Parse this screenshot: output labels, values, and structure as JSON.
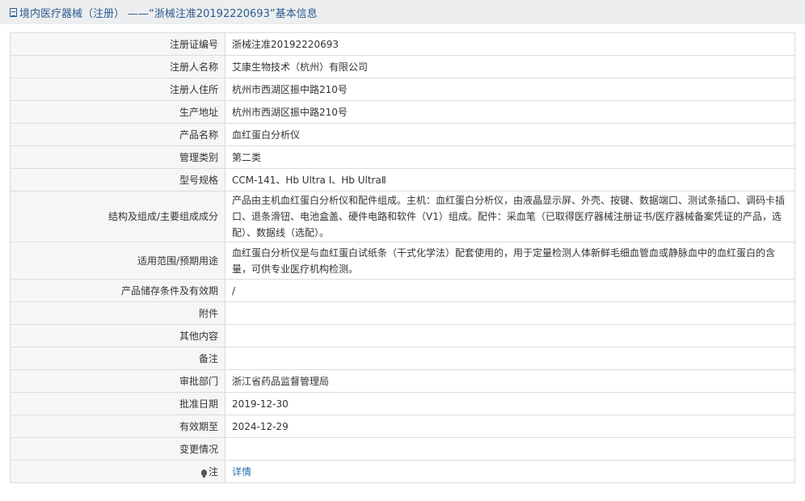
{
  "header": {
    "title": "境内医疗器械（注册） ——“浙械注准20192220693”基本信息"
  },
  "rows": [
    {
      "label": "注册证编号",
      "value": "浙械注准20192220693"
    },
    {
      "label": "注册人名称",
      "value": "艾康生物技术（杭州）有限公司"
    },
    {
      "label": "注册人住所",
      "value": "杭州市西湖区振中路210号"
    },
    {
      "label": "生产地址",
      "value": "杭州市西湖区振中路210号"
    },
    {
      "label": "产品名称",
      "value": "血红蛋白分析仪"
    },
    {
      "label": "管理类别",
      "value": "第二类"
    },
    {
      "label": "型号规格",
      "value": "CCM-141、Hb Ultra Ⅰ、Hb UltraⅡ"
    },
    {
      "label": "结构及组成/主要组成成分",
      "value": "产品由主机血红蛋白分析仪和配件组成。主机：血红蛋白分析仪，由液晶显示屏、外壳、按键、数据端口、测试条插口、调码卡插口、退条滑钮、电池盒盖、硬件电路和软件（V1）组成。配件：采血笔（已取得医疗器械注册证书/医疗器械备案凭证的产品，选配）、数据线（选配）。"
    },
    {
      "label": "适用范围/预期用途",
      "value": "血红蛋白分析仪是与血红蛋白试纸条（干式化学法）配套使用的，用于定量检测人体新鲜毛细血管血或静脉血中的血红蛋白的含量，可供专业医疗机构检测。"
    },
    {
      "label": "产品储存条件及有效期",
      "value": "/"
    },
    {
      "label": "附件",
      "value": ""
    },
    {
      "label": "其他内容",
      "value": ""
    },
    {
      "label": "备注",
      "value": ""
    },
    {
      "label": "审批部门",
      "value": "浙江省药品监督管理局"
    },
    {
      "label": "批准日期",
      "value": "2019-12-30"
    },
    {
      "label": "有效期至",
      "value": "2024-12-29"
    },
    {
      "label": "变更情况",
      "value": ""
    },
    {
      "label": "注",
      "value": "详情"
    }
  ],
  "icons": {
    "title_icon": "document-icon",
    "note_icon": "lightbulb-icon"
  },
  "colors": {
    "title_text": "#2b5b91",
    "link": "#2b6cb0",
    "label_bg": "#f6f6f6",
    "border": "#dcdcdc"
  }
}
